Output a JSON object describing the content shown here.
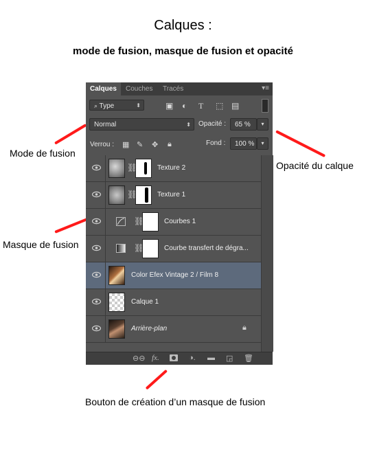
{
  "heading": {
    "title": "Calques :",
    "subtitle": "mode de fusion, masque de fusion et opacité"
  },
  "annotations": {
    "blend_mode": "Mode de fusion",
    "opacity": "Opacité du calque",
    "mask": "Masque de fusion",
    "mask_button": "Bouton de création d’un masque de fusion",
    "arrow_color": "#ff1a1a"
  },
  "panel": {
    "tabs": [
      "Calques",
      "Couches",
      "Tracés"
    ],
    "active_tab": "Calques",
    "filter": {
      "icon": "search-icon",
      "value": "Type"
    },
    "blend_mode": "Normal",
    "opacity_label": "Opacité :",
    "opacity_value": "65 %",
    "lock_label": "Verrou :",
    "fill_label": "Fond :",
    "fill_value": "100 %",
    "selected_color": "#5d6a7c",
    "layers": [
      {
        "name": "Texture 2",
        "thumb": "texture",
        "has_mask": true,
        "visible": true
      },
      {
        "name": "Texture 1",
        "thumb": "texture",
        "has_mask": true,
        "visible": true
      },
      {
        "name": "Courbes 1",
        "thumb": "curves-adjustment-icon",
        "has_mask": true,
        "visible": true
      },
      {
        "name": "Courbe transfert de dégra...",
        "thumb": "gradient-map-icon",
        "has_mask": true,
        "visible": true
      },
      {
        "name": "Color Efex Vintage 2 / Film 8",
        "thumb": "photo",
        "has_mask": false,
        "visible": true,
        "selected": true
      },
      {
        "name": "Calque 1",
        "thumb": "transparent",
        "has_mask": false,
        "visible": true
      },
      {
        "name": "Arrière-plan",
        "thumb": "photo",
        "has_mask": false,
        "visible": true,
        "locked": true
      }
    ],
    "bottom_icons": [
      "link-icon",
      "fx-icon",
      "add-mask-icon",
      "adjustment-icon",
      "group-folder-icon",
      "new-layer-icon",
      "trash-icon"
    ]
  }
}
